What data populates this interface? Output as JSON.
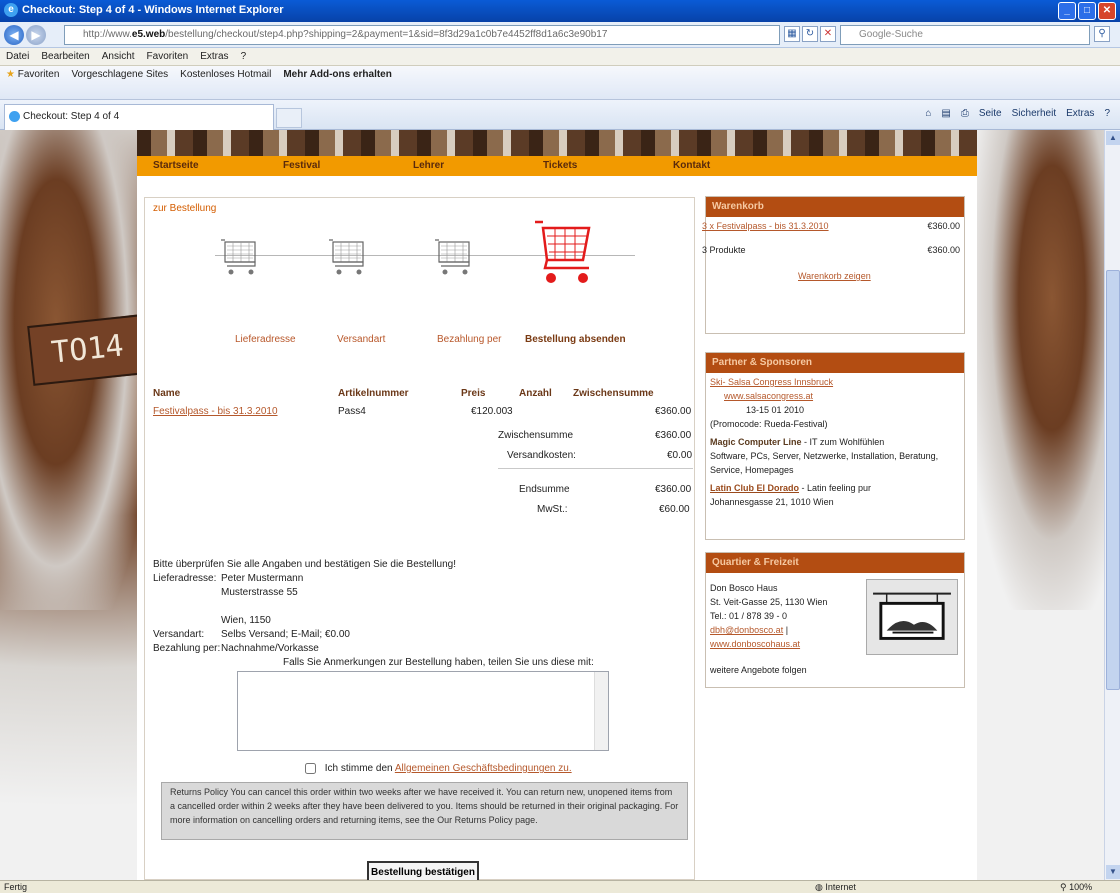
{
  "window": {
    "title": "Checkout: Step 4 of 4 - Windows Internet Explorer"
  },
  "address": {
    "url_prefix": "http://www.",
    "url_bold": "e5.web",
    "url_rest": "/bestellung/checkout/step4.php?shipping=2&payment=1&sid=8f3d29a1c0b7e4452ff8d1a6c3e90b17",
    "search_placeholder": "Google-Suche"
  },
  "menu": [
    "Datei",
    "Bearbeiten",
    "Ansicht",
    "Favoriten",
    "Extras",
    "?"
  ],
  "favorites": {
    "label": "Favoriten",
    "items": [
      "Vorgeschlagene Sites",
      "Kostenloses Hotmail",
      "Mehr Add-ons erhalten"
    ]
  },
  "tab": {
    "title": "Checkout: Step 4 of 4"
  },
  "commandbar": [
    "Seite",
    "Sicherheit",
    "Extras"
  ],
  "status": {
    "done": "Fertig",
    "zone": "Internet",
    "zoom": "100%"
  },
  "nav": [
    "Startseite",
    "Festival",
    "Lehrer",
    "Tickets",
    "Kontakt"
  ],
  "content": {
    "breadcrumb": "zur Bestellung",
    "steps": [
      {
        "label": "Lieferadresse",
        "active": false
      },
      {
        "label": "Versandart",
        "active": false
      },
      {
        "label": "Bezahlung per",
        "active": false
      },
      {
        "label": "Bestellung absenden",
        "active": true
      }
    ],
    "table": {
      "headers": {
        "name": "Name",
        "article": "Artikelnummer",
        "price": "Preis",
        "qty": "Anzahl",
        "subtotal": "Zwischensumme"
      },
      "row": {
        "name": "Festivalpass - bis 31.3.2010",
        "article": "Pass4",
        "price": "€120.00",
        "qty": "3",
        "subtotal": "€360.00"
      },
      "summary": [
        {
          "label": "Zwischensumme",
          "value": "€360.00"
        },
        {
          "label": "Versandkosten:",
          "value": "€0.00"
        },
        {
          "label": "Endsumme",
          "value": "€360.00"
        },
        {
          "label": "MwSt.:",
          "value": "€60.00"
        }
      ]
    },
    "review": {
      "intro": "Bitte überprüfen Sie alle Angaben und bestätigen Sie die Bestellung!",
      "address_label": "Lieferadresse:",
      "address_lines": [
        "Peter Mustermann",
        "Musterstrasse 55",
        "",
        "Wien, 1150"
      ],
      "shipping_label": "Versandart:",
      "shipping_value": "Selbs Versand; E-Mail; €0.00",
      "payment_label": "Bezahlung per:",
      "payment_value": "Nachnahme/Vorkasse"
    },
    "remarks_label": "Falls Sie Anmerkungen zur Bestellung haben, teilen Sie uns diese mit:",
    "agb_prefix": "Ich stimme den",
    "agb_link": "Allgemeinen Geschäftsbedingungen zu.",
    "policy": "Returns Policy You can cancel this order within two weeks after we have received it. You can return new, unopened items from a cancelled order within 2 weeks after they have been delivered to you. Items should be returned in their original packaging. For more information on cancelling orders and returning items, see the Our Returns Policy page.",
    "confirm_button": "Bestellung bestätigen"
  },
  "sidebar": {
    "cart": {
      "title": "Warenkorb",
      "item": "3 x Festivalpass - bis 31.3.2010",
      "item_price": "€360.00",
      "count": "3 Produkte",
      "count_price": "€360.00",
      "show_link": "Warenkorb zeigen"
    },
    "partners": {
      "title": "Partner & Sponsoren",
      "p1_link": "Ski- Salsa Congress Innsbruck",
      "p1_url": "www.salsacongress.at",
      "p1_date": "13-15 01 2010",
      "p1_promo": "(Promocode: Rueda-Festival)",
      "p2_name": "Magic Computer Line",
      "p2_tag": "- IT zum Wohlfühlen",
      "p2_desc": "Software, PCs, Server, Netzwerke, Installation, Beratung, Service, Homepages",
      "p3_name": "Latin Club El Dorado",
      "p3_tag": "- Latin feeling pur",
      "p3_addr": "Johannesgasse 21, 1010 Wien"
    },
    "quarter": {
      "title": "Quartier & Freizeit",
      "name": "Don Bosco Haus",
      "addr": "St. Veit-Gasse 25, 1130 Wien",
      "tel": "Tel.: 01 / 878 39 - 0",
      "email": "dbh@donbosco.at",
      "email_sep": "|",
      "web": "www.donboscohaus.at",
      "more": "weitere Angebote folgen"
    }
  }
}
